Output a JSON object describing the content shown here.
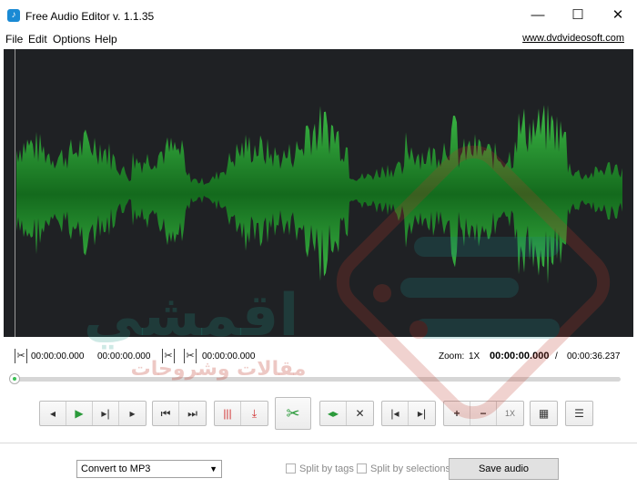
{
  "window": {
    "title": "Free Audio Editor v. 1.1.35",
    "icons": {
      "app": "app-logo-icon",
      "minimize": "minimize-icon",
      "maximize": "maximize-icon",
      "close": "close-icon"
    }
  },
  "menu": {
    "items": [
      "File",
      "Edit",
      "Options",
      "Help"
    ],
    "site_link": "www.dvdvideosoft.com"
  },
  "waveform": {
    "color": "#2ea43a",
    "background": "#1f2124"
  },
  "info": {
    "selection_start": "00:00:00.000",
    "selection_end": "00:00:00.000",
    "cut_position": "00:00:00.000",
    "zoom_label": "Zoom:",
    "zoom_value": "1X",
    "current_time": "00:00:00.000",
    "separator": "/",
    "total_time": "00:00:36.237"
  },
  "position": {
    "fraction": 0.0
  },
  "controls": {
    "playback": [
      "step-back-icon",
      "play-icon",
      "play-to-end-icon",
      "step-forward-icon"
    ],
    "navigation": [
      "go-start-icon",
      "go-end-icon"
    ],
    "markers": [
      "marker-icon",
      "add-marker-icon"
    ],
    "cut": "scissors-icon",
    "selection": [
      "select-both-icon",
      "clear-selection-icon"
    ],
    "range": [
      "select-start-icon",
      "select-end-icon"
    ],
    "zoom": {
      "in": "+",
      "out": "−",
      "level": "1X"
    },
    "extra": [
      "image-icon",
      "settings-icon"
    ]
  },
  "bottom": {
    "format_selected": "Convert to MP3",
    "split_tags_label": "Split by tags",
    "split_selections_label": "Split by selections",
    "save_label": "Save audio"
  },
  "watermark": {
    "text_1": "اقمشي",
    "text_2": "مقالات وشروحات"
  }
}
